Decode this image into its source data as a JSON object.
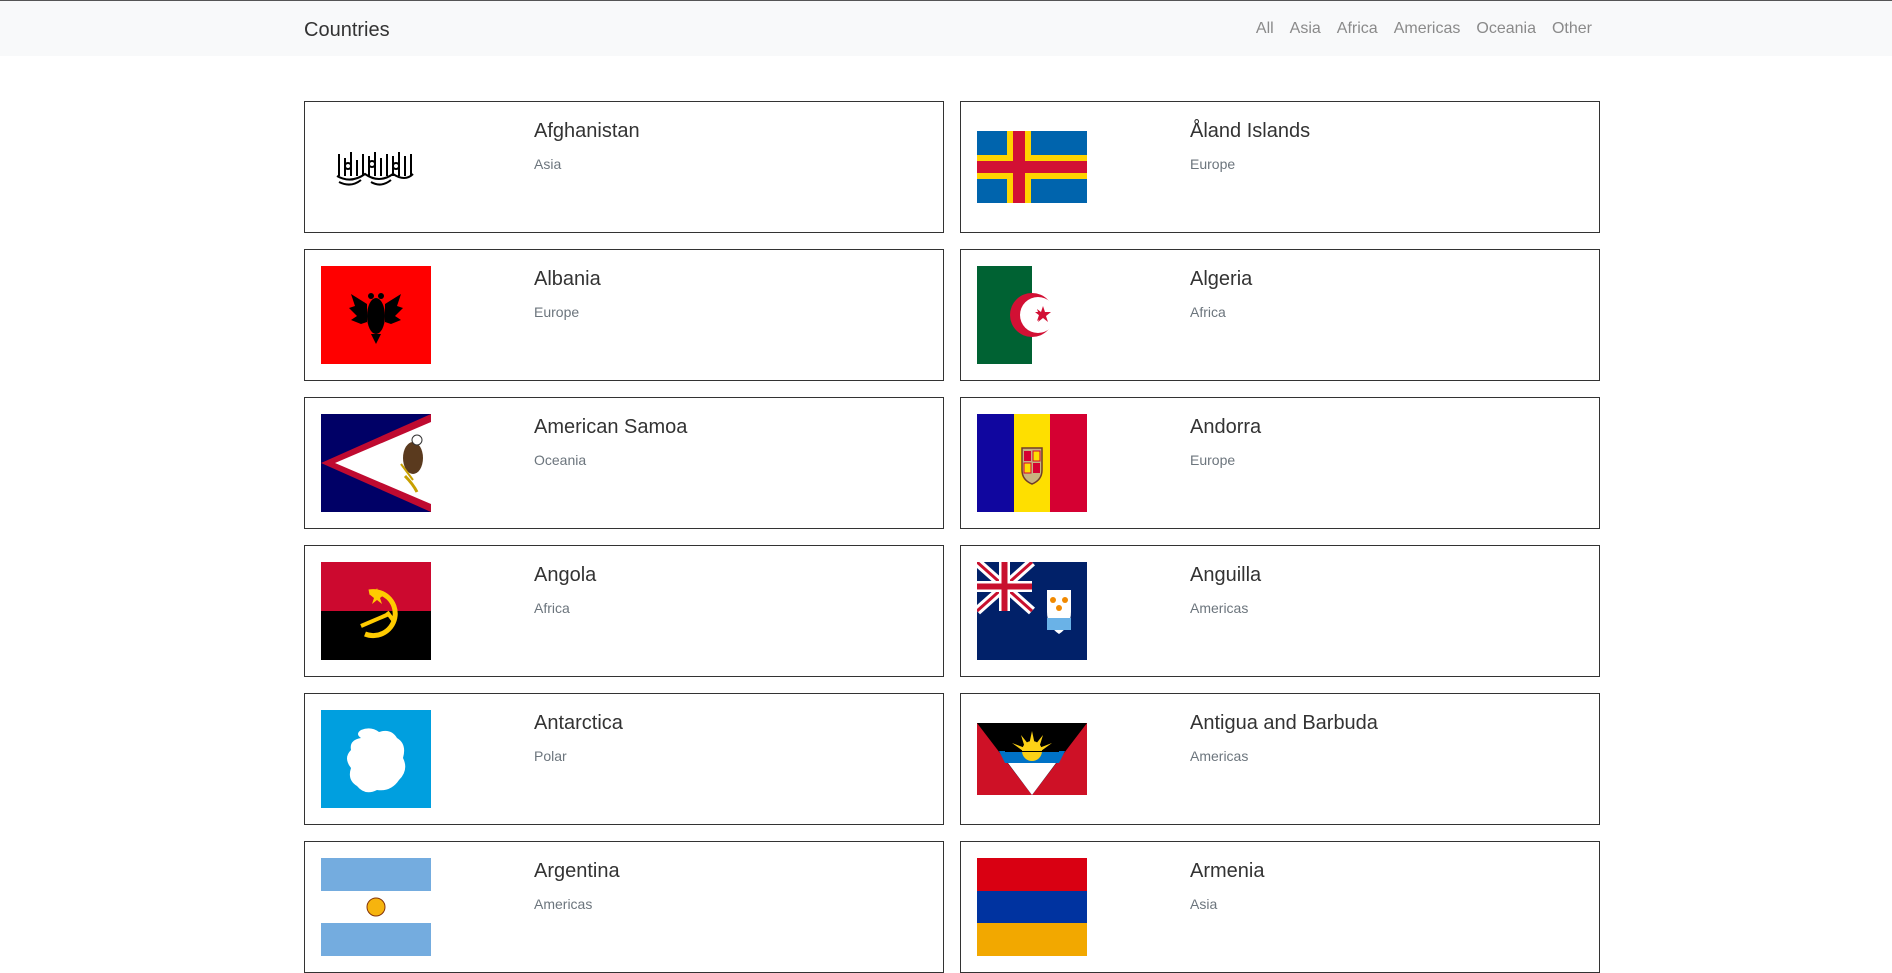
{
  "navbar": {
    "brand": "Countries",
    "links": [
      "All",
      "Asia",
      "Africa",
      "Americas",
      "Oceania",
      "Other"
    ]
  },
  "countries": [
    {
      "name": "Afghanistan",
      "region": "Asia",
      "flag_icon": "afghanistan-flag-icon"
    },
    {
      "name": "Åland Islands",
      "region": "Europe",
      "flag_icon": "aland-islands-flag-icon"
    },
    {
      "name": "Albania",
      "region": "Europe",
      "flag_icon": "albania-flag-icon"
    },
    {
      "name": "Algeria",
      "region": "Africa",
      "flag_icon": "algeria-flag-icon"
    },
    {
      "name": "American Samoa",
      "region": "Oceania",
      "flag_icon": "american-samoa-flag-icon"
    },
    {
      "name": "Andorra",
      "region": "Europe",
      "flag_icon": "andorra-flag-icon"
    },
    {
      "name": "Angola",
      "region": "Africa",
      "flag_icon": "angola-flag-icon"
    },
    {
      "name": "Anguilla",
      "region": "Americas",
      "flag_icon": "anguilla-flag-icon"
    },
    {
      "name": "Antarctica",
      "region": "Polar",
      "flag_icon": "antarctica-flag-icon"
    },
    {
      "name": "Antigua and Barbuda",
      "region": "Americas",
      "flag_icon": "antigua-and-barbuda-flag-icon"
    },
    {
      "name": "Argentina",
      "region": "Americas",
      "flag_icon": "argentina-flag-icon"
    },
    {
      "name": "Armenia",
      "region": "Asia",
      "flag_icon": "armenia-flag-icon"
    }
  ]
}
